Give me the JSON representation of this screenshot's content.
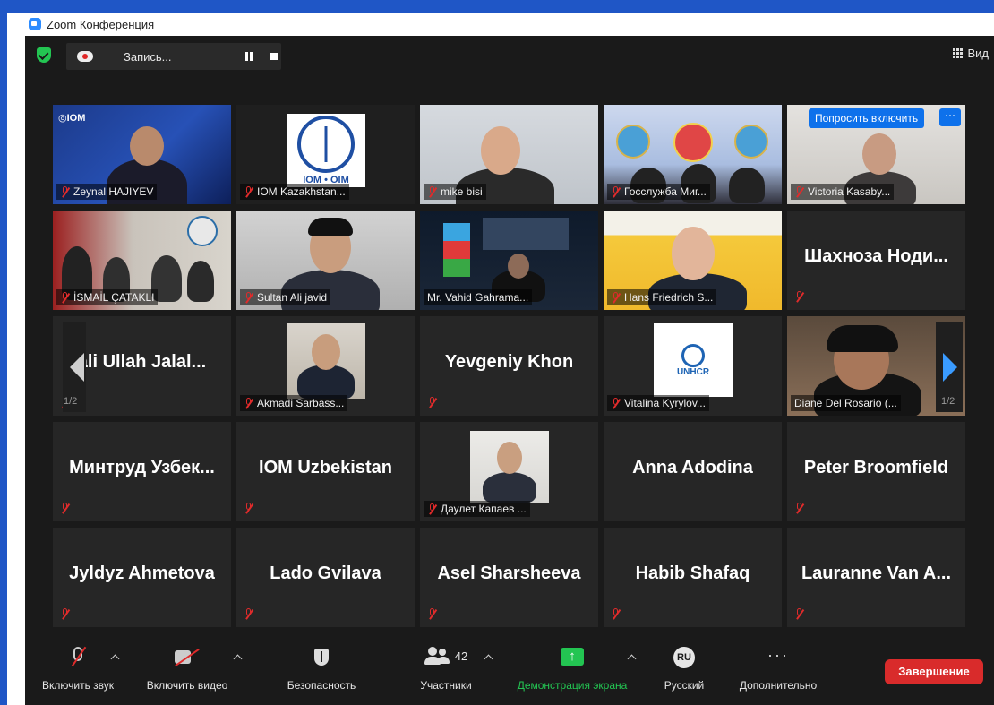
{
  "window": {
    "title": "Zoom Конференция"
  },
  "recording": {
    "label": "Запись..."
  },
  "view": {
    "label": "Вид"
  },
  "tiles": [
    {
      "name": "Zeynal HAJIYEV",
      "kind": "video"
    },
    {
      "name": "IOM Kazakhstan...",
      "kind": "video",
      "logo": "IOM • OIM"
    },
    {
      "name": "mike bisi",
      "kind": "video"
    },
    {
      "name": "Госслужба Миг...",
      "kind": "video"
    },
    {
      "name": "Victoria Kasaby...",
      "kind": "video"
    },
    {
      "name": "İSMAİL ÇATAKLI",
      "kind": "video"
    },
    {
      "name": "Sultan Ali javid",
      "kind": "video"
    },
    {
      "name": "Mr. Vahid Gahrama...",
      "kind": "video"
    },
    {
      "name": "Hans Friedrich S...",
      "kind": "video"
    },
    {
      "name": "Шахноза  Ноди...",
      "kind": "name-only"
    },
    {
      "name": "ali Ullah Jalal...",
      "kind": "name-only"
    },
    {
      "name": "Akmadi Sarbass...",
      "kind": "video"
    },
    {
      "name": "Yevgeniy Khon",
      "kind": "name-only"
    },
    {
      "name": "Vitalina Kyrylov...",
      "kind": "video",
      "logo": "UNHCR"
    },
    {
      "name": "Diane Del Rosario (...",
      "kind": "video",
      "active": true
    },
    {
      "name": "Минтруд  Узбек...",
      "kind": "name-only"
    },
    {
      "name": "IOM Uzbekistan",
      "kind": "name-only"
    },
    {
      "name": "Даулет Капаев ...",
      "kind": "video"
    },
    {
      "name": "Anna Adodina",
      "kind": "name-only"
    },
    {
      "name": "Peter Broomfield",
      "kind": "name-only"
    },
    {
      "name": "Jyldyz Ahmetova",
      "kind": "name-only"
    },
    {
      "name": "Lado Gvilava",
      "kind": "name-only"
    },
    {
      "name": "Asel Sharsheeva",
      "kind": "name-only"
    },
    {
      "name": "Habib Shafaq",
      "kind": "name-only"
    },
    {
      "name": "Lauranne Van A...",
      "kind": "name-only"
    }
  ],
  "tile_actions": {
    "request_label": "Попросить включить",
    "more_label": "···"
  },
  "paging": {
    "left_page": "1/2",
    "right_page": "1/2"
  },
  "toolbar": {
    "unmute_label": "Включить звук",
    "video_label": "Включить видео",
    "security_label": "Безопасность",
    "participants_label": "Участники",
    "participants_count": "42",
    "share_label": "Демонстрация экрана",
    "language_label": "Русский",
    "language_code": "RU",
    "more_label": "Дополнительно",
    "more_dots": "···",
    "end_label": "Завершение"
  },
  "colors": {
    "accent": "#0e71eb",
    "share_green": "#23c552",
    "end_red": "#d92b2b",
    "active_speaker": "#c9e96a",
    "muted_red": "#e02b2b"
  }
}
